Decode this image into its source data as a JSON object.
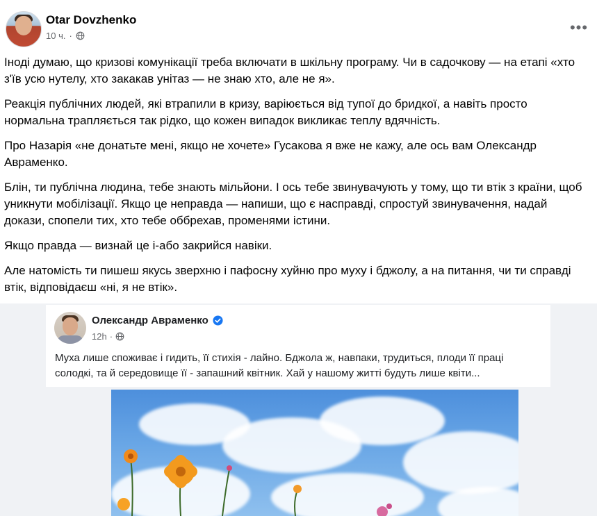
{
  "post": {
    "author": "Otar Dovzhenko",
    "time": "10 ч.",
    "dot": "·",
    "more_label": "•••",
    "paragraphs": [
      "Іноді думаю, що кризові комунікації треба включати в шкільну програму. Чи в садочкову — на етапі «хто з'їв усю нутелу, хто закакав унітаз — не знаю хто, але не я».",
      "Реакція публічних людей, які втрапили в кризу, варіюється від тупої до бридкої, а навіть просто нормальна трапляється так рідко, що кожен випадок викликає теплу вдячність.",
      "Про Назарія «не донатьте мені, якщо не хочете» Гусакова я вже не кажу, але ось вам Олександр Авраменко.",
      "Блін, ти публічна людина, тебе знають мільйони. І ось тебе звинувачують у тому, що ти втік з країни, щоб уникнути мобілізації. Якщо це неправда — напиши, що є насправді, спростуй звинувачення, надай докази, спопели тих, хто тебе оббрехав, променями істини.",
      "Якщо правда — визнай це і-або закрийся навіки.",
      "Але натомість ти пишеш якусь зверхню і пафосну хуйню про муху і бджолу, а на питання, чи ти справді втік, відповідаєш «ні, я не втік»."
    ]
  },
  "embedded_post": {
    "author": "Олександр Авраменко",
    "time": "12h",
    "dot": "·",
    "text": "Муха лише споживає і гидить, її стихія - лайно. Бджола ж, навпаки, трудиться, плоди її праці солодкі, та й середовище її - запашний квітник. Хай у нашому житті будуть лише квіти..."
  },
  "icons": {
    "globe": "globe-icon",
    "verified": "verified-badge-icon",
    "more": "more-options-icon"
  },
  "colors": {
    "accent": "#1877f2",
    "secondary_text": "#65676b",
    "background": "#f0f2f5"
  }
}
